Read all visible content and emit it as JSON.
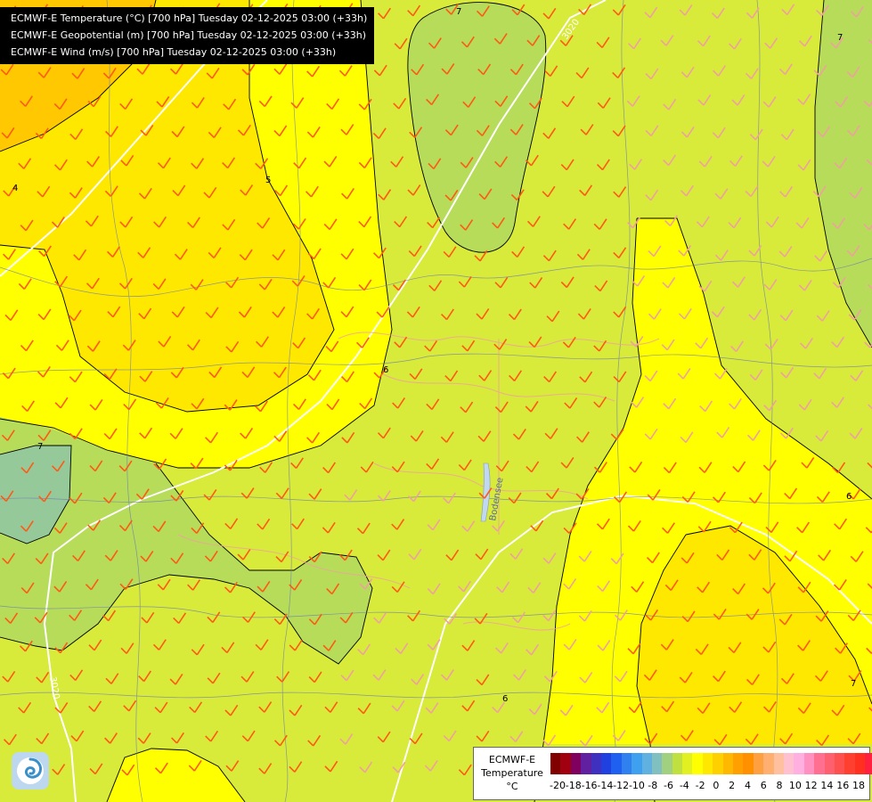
{
  "titles": [
    "ECMWF-E Temperature (°C) [700 hPa] Tuesday 02-12-2025 03:00 (+33h)",
    "ECMWF-E Geopotential (m) [700 hPa] Tuesday 02-12-2025 03:00 (+33h)",
    "ECMWF-E Wind (m/s) [700 hPa] Tuesday 02-12-2025 03:00 (+33h)"
  ],
  "map": {
    "isotherm_labels": [
      "7",
      "7",
      "4",
      "5",
      "6",
      "6",
      "6",
      "7",
      "7"
    ],
    "geopotential_labels": [
      "3020",
      "3020"
    ],
    "place_label": "Bodensee",
    "colors": {
      "green": "#b6dc5a",
      "dark_green": "#96c99a",
      "yellow": "#ffff00",
      "gold": "#ffdc00",
      "orange": "#ffc800",
      "wind_barb": "#ff5a14",
      "wind_barb_light": "#f0a0a0"
    }
  },
  "legend": {
    "name_lines": [
      "ECMWF-E",
      "Temperature",
      "°C"
    ],
    "tick_labels": [
      "-20",
      "-18",
      "-16",
      "-14",
      "-12",
      "-10",
      "-8",
      "-6",
      "-4",
      "-2",
      "0",
      "2",
      "4",
      "6",
      "8",
      "10",
      "12",
      "14",
      "16",
      "18"
    ],
    "colors": [
      "#800000",
      "#a00010",
      "#800060",
      "#6020a0",
      "#4030c0",
      "#2040e0",
      "#2060f0",
      "#3080f0",
      "#40a0f0",
      "#60b0e0",
      "#80c0c0",
      "#a0d080",
      "#c0e040",
      "#e0f020",
      "#ffff00",
      "#ffe800",
      "#ffd000",
      "#ffb800",
      "#ffa000",
      "#ff9000",
      "#ffa040",
      "#ffb070",
      "#ffc0a0",
      "#ffc0d0",
      "#ffb0e0",
      "#ff90c0",
      "#ff7090",
      "#ff6070",
      "#ff5050",
      "#ff4030",
      "#ff3020",
      "#ff2040",
      "#ff2080",
      "#ff20b0",
      "#ff20e0"
    ]
  }
}
